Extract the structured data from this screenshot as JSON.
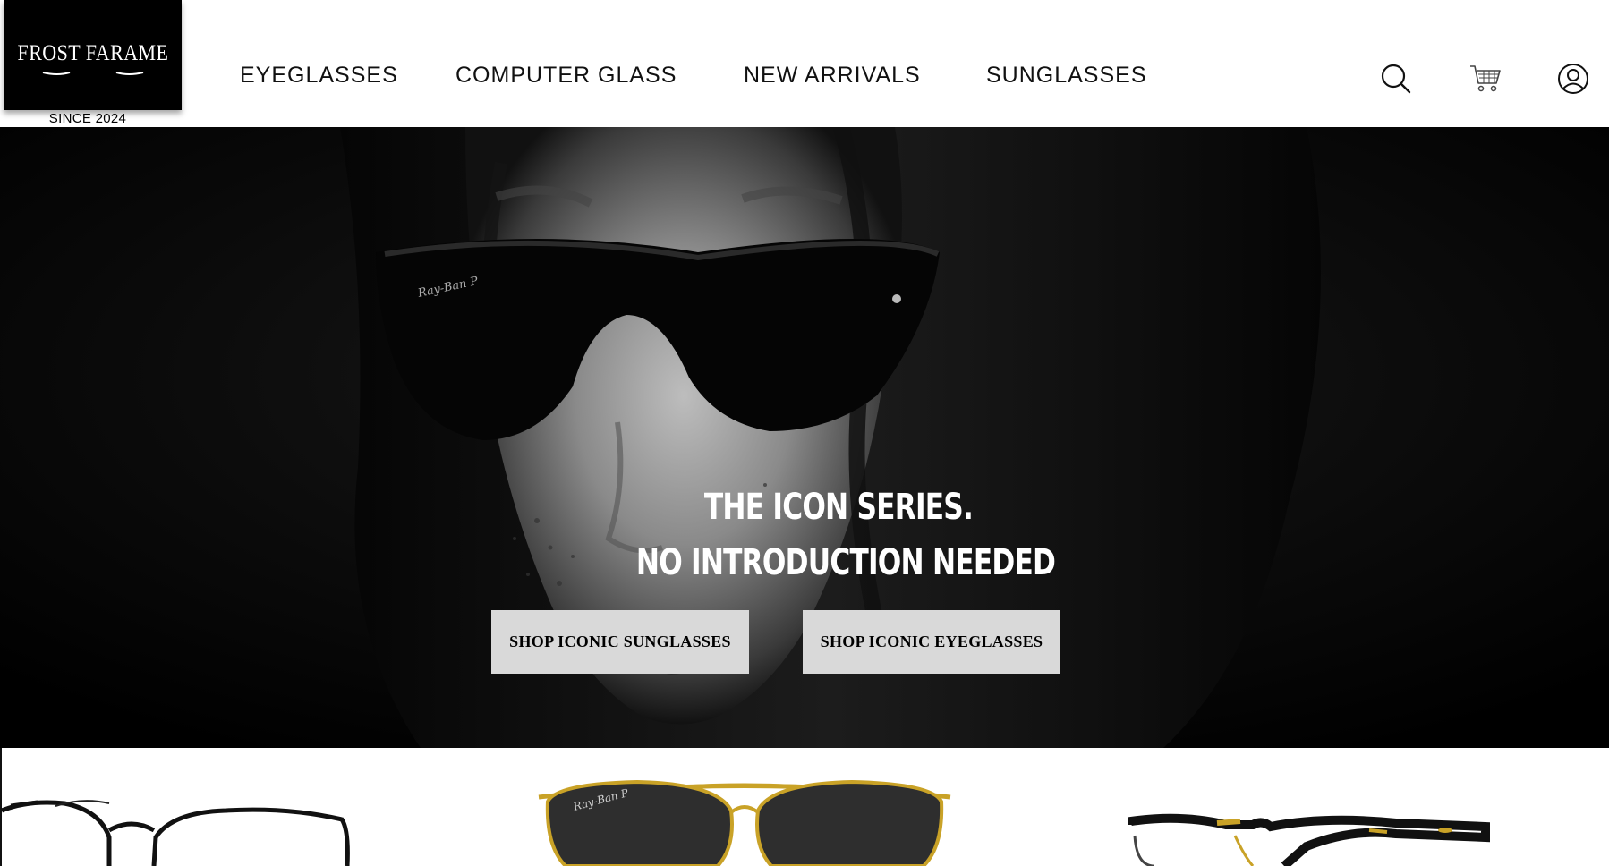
{
  "brand": {
    "name": "FROST FARAME",
    "tagline": "SINCE 2024"
  },
  "nav": {
    "items": [
      {
        "label": "EYEGLASSES"
      },
      {
        "label": "COMPUTER GLASS"
      },
      {
        "label": "NEW ARRIVALS"
      },
      {
        "label": "SUNGLASSES"
      }
    ]
  },
  "header_icons": [
    "search-icon",
    "cart-icon",
    "user-account-icon"
  ],
  "hero": {
    "headline_line1": "THE ICON SERIES.",
    "headline_line2": "NO INTRODUCTION NEEDED",
    "cta_sunglasses": "SHOP ICONIC SUNGLASSES",
    "cta_eyeglasses": "SHOP ICONIC EYEGLASSES"
  },
  "colors": {
    "logo_background": "#000000",
    "hero_background": "#000000",
    "cta_background": "#d9d9d9",
    "headline_text": "#ffffff"
  }
}
